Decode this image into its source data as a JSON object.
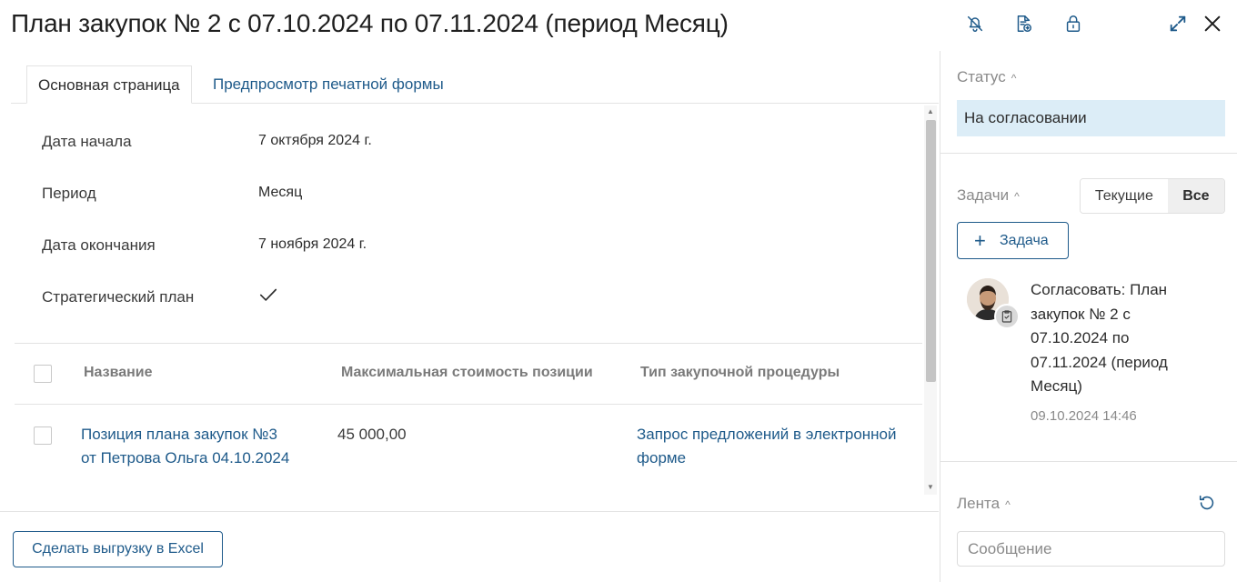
{
  "header": {
    "title": "План закупок № 2 с 07.10.2024 по 07.11.2024 (период Месяц)",
    "icons": [
      "bell-off-icon",
      "document-export-icon",
      "lock-icon",
      "expand-icon",
      "close-icon"
    ]
  },
  "tabs": [
    {
      "label": "Основная страница",
      "active": true
    },
    {
      "label": "Предпросмотр печатной формы",
      "active": false
    }
  ],
  "fields": [
    {
      "label": "Дата начала",
      "value": "7 октября 2024 г."
    },
    {
      "label": "Период",
      "value": "Месяц"
    },
    {
      "label": "Дата окончания",
      "value": "7 ноября 2024 г."
    },
    {
      "label": "Стратегический план",
      "value": "",
      "checked": true
    }
  ],
  "table": {
    "columns": [
      "Название",
      "Максимальная стоимость позиции",
      "Тип закупочной процедуры"
    ],
    "rows": [
      {
        "name_line1": "Позиция плана закупок №3",
        "name_line2": "от Петрова Ольга 04.10.2024",
        "cost": "45 000,00",
        "type_line1": "Запрос предложений в электронной",
        "type_line2": "форме"
      }
    ]
  },
  "footer": {
    "excel_button": "Сделать выгрузку в Excel"
  },
  "sidebar": {
    "status": {
      "title": "Статус",
      "value": "На согласовании"
    },
    "tasks": {
      "title": "Задачи",
      "filter_current": "Текущие",
      "filter_all": "Все",
      "add_button": "Задача",
      "items": [
        {
          "line1": "Согласовать: План",
          "line2": "закупок № 2 с",
          "line3": "07.10.2024 по",
          "line4": "07.11.2024 (период",
          "line5": "Месяц)",
          "date": "09.10.2024 14:46"
        }
      ]
    },
    "feed": {
      "title": "Лента",
      "placeholder": "Сообщение"
    }
  },
  "colors": {
    "accent": "#1e5a8a",
    "status_bg": "#dcedf7",
    "border": "#e3e3e3"
  }
}
